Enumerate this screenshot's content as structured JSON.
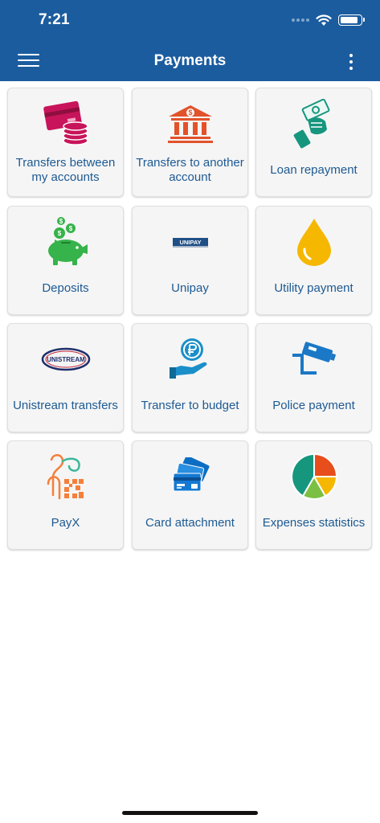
{
  "status_bar": {
    "time": "7:21"
  },
  "header": {
    "title": "Payments"
  },
  "tiles": [
    {
      "label": "Transfers between my accounts",
      "icon": "card-coins-icon"
    },
    {
      "label": "Transfers to another account",
      "icon": "bank-icon"
    },
    {
      "label": "Loan repayment",
      "icon": "hand-money-icon"
    },
    {
      "label": "Deposits",
      "icon": "piggy-bank-icon"
    },
    {
      "label": "Unipay",
      "icon": "unipay-logo",
      "logo_text": "UNIPAY"
    },
    {
      "label": "Utility payment",
      "icon": "oil-drop-icon"
    },
    {
      "label": "Unistream transfers",
      "icon": "unistream-logo",
      "logo_text": "UNISTREAM"
    },
    {
      "label": "Transfer to budget",
      "icon": "hand-coin-icon"
    },
    {
      "label": "Police payment",
      "icon": "police-camera-icon"
    },
    {
      "label": "PayX",
      "icon": "payx-icon"
    },
    {
      "label": "Card attachment",
      "icon": "cards-icon"
    },
    {
      "label": "Expenses statistics",
      "icon": "pie-chart-icon"
    }
  ],
  "colors": {
    "header_bg": "#1b5c9f",
    "label_text": "#1d5a93",
    "tile_bg": "#f5f5f5"
  }
}
